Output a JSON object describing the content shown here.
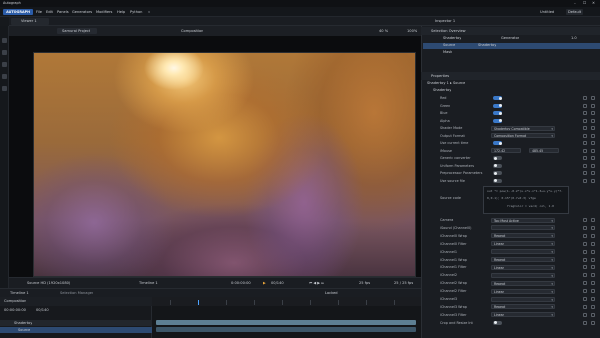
{
  "app": {
    "title": "Autograph",
    "version_badge": "v",
    "window_controls": [
      "–",
      "☐",
      "✕"
    ]
  },
  "menu": {
    "logo": "AUTOGRAPH",
    "items": [
      "File",
      "Edit",
      "Panels",
      "Generators",
      "Modifiers",
      "Help",
      "Python"
    ],
    "right": [
      "Untitled",
      "Default"
    ]
  },
  "viewer": {
    "tab": "Viewer 1",
    "project": "Samurai Project",
    "mode": "Composition",
    "zoom": "40 %",
    "percent": "100%"
  },
  "viewer_status": {
    "source": "Source HD (1920x1080)",
    "timeline": "Timeline 1",
    "timecode": "0:00:00:00",
    "frame": "00/140",
    "fps": "25 fps",
    "right": "25 / 25 fps"
  },
  "timeline": {
    "tab": "Timeline 1",
    "secondary_tab": "Selection Manager",
    "composition": "Composition",
    "timecode": "00:00:00:00",
    "frames": "00/140",
    "lock": "Locked",
    "row1": "Shadertoy",
    "row2": "Source"
  },
  "inspector": {
    "tab": "Inspector 1",
    "selection_title": "Selection Overview",
    "selection_rows": [
      {
        "name": "Shadertoy",
        "type": "Generator",
        "value": "1.0"
      },
      {
        "name": "Source",
        "type": "Shadertoy",
        "value": ""
      },
      {
        "name": "Mask",
        "type": "",
        "value": ""
      }
    ],
    "properties_title": "Properties",
    "breadcrumb": "Shadertoy 1 ▸ Source",
    "group": "Shadertoy",
    "rows": [
      {
        "label": "Red",
        "kind": "toggle",
        "on": true
      },
      {
        "label": "Green",
        "kind": "toggle",
        "on": true
      },
      {
        "label": "Blue",
        "kind": "toggle",
        "on": true
      },
      {
        "label": "Alpha",
        "kind": "toggle",
        "on": true
      },
      {
        "label": "Shader Mode",
        "kind": "drop",
        "value": "Shadertoy Compatible"
      },
      {
        "label": "Output Format",
        "kind": "drop",
        "value": "Composition Format"
      },
      {
        "label": "Use current time",
        "kind": "toggle",
        "on": true
      },
      {
        "label": "iMouse",
        "kind": "nums",
        "a": "172.42",
        "b": "485.45"
      },
      {
        "label": "Generic converter",
        "kind": "toggle",
        "on": false
      },
      {
        "label": "Uniform Parameters",
        "kind": "toggle",
        "on": false
      },
      {
        "label": "Preprocessor Parameters",
        "kind": "toggle",
        "on": false
      },
      {
        "label": "Use source file",
        "kind": "toggle",
        "on": false
      }
    ],
    "source_code": [
      "out *= pow(1.-0.2*(u.x*u.x*1.3+u.y*u.y)*7.",
      "0,0.1);  0.15*(0.7+0.3)  vTge",
      "fragColor = vec4( col, 1.0"
    ],
    "source_code_label": "Source code",
    "rows2": [
      {
        "label": "Camera",
        "kind": "drop",
        "value": "Top Most Active"
      },
      {
        "label": "iSound (Channel0)",
        "kind": "drop",
        "value": ""
      },
      {
        "label": "iChannel0 Wrap",
        "kind": "drop",
        "value": "Repeat"
      },
      {
        "label": "iChannel0 Filter",
        "kind": "drop",
        "value": "Linear"
      },
      {
        "label": "iChannel1",
        "kind": "drop",
        "value": ""
      },
      {
        "label": "iChannel1 Wrap",
        "kind": "drop",
        "value": "Repeat"
      },
      {
        "label": "iChannel1 Filter",
        "kind": "drop",
        "value": "Linear"
      },
      {
        "label": "iChannel2",
        "kind": "drop",
        "value": ""
      },
      {
        "label": "iChannel2 Wrap",
        "kind": "drop",
        "value": "Repeat"
      },
      {
        "label": "iChannel2 Filter",
        "kind": "drop",
        "value": "Linear"
      },
      {
        "label": "iChannel3",
        "kind": "drop",
        "value": ""
      },
      {
        "label": "iChannel3 Wrap",
        "kind": "drop",
        "value": "Repeat"
      },
      {
        "label": "iChannel3 Filter",
        "kind": "drop",
        "value": "Linear"
      },
      {
        "label": "Crop and Resize Int",
        "kind": "toggle",
        "on": false
      }
    ]
  },
  "colors": {
    "accent": "#3a78c8",
    "logo": "#2b5ca8",
    "panel": "#1a1d22",
    "bg": "#16191d"
  }
}
